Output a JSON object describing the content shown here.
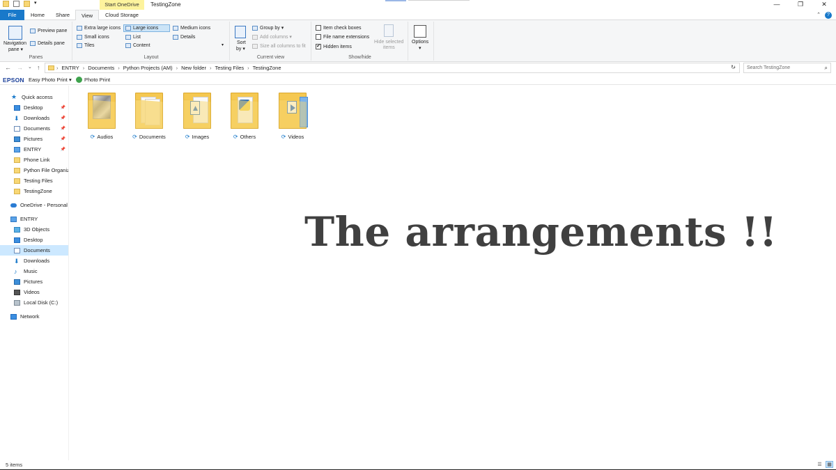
{
  "window": {
    "title": "TestingZone",
    "contextual_tab": "Start OneDrive",
    "controls": {
      "minimize": "—",
      "maximize": "❐",
      "close": "✕"
    }
  },
  "ribbon_tabs": {
    "file": "File",
    "home": "Home",
    "share": "Share",
    "view": "View",
    "cloud": "Cloud Storage",
    "help": "?"
  },
  "ribbon": {
    "panes": {
      "title": "Panes",
      "navigation_pane": "Navigation",
      "navigation_pane_sub": "pane ▾",
      "preview_pane": "Preview pane",
      "details_pane": "Details pane"
    },
    "layout": {
      "title": "Layout",
      "extra_large": "Extra large icons",
      "large": "Large icons",
      "medium": "Medium icons",
      "small": "Small icons",
      "list": "List",
      "details": "Details",
      "tiles": "Tiles",
      "content": "Content"
    },
    "current_view": {
      "title": "Current view",
      "sort": "Sort",
      "sort_sub": "by ▾",
      "group_by": "Group by ▾",
      "add_columns": "Add columns ▾",
      "size_columns": "Size all columns to fit"
    },
    "show_hide": {
      "title": "Show/hide",
      "item_checkboxes": "Item check boxes",
      "file_extensions": "File name extensions",
      "hidden_items": "Hidden items",
      "hidden_checked": "✔",
      "hide_selected": "Hide selected",
      "hide_selected_sub": "items"
    },
    "options": {
      "label": "Options",
      "arrow": "▾"
    }
  },
  "address_bar": {
    "back": "←",
    "forward": "→",
    "recent": "⌄",
    "up": "↑",
    "breadcrumbs": [
      "ENTRY",
      "Documents",
      "Python Projects (AM)",
      "New folder",
      "Testing Files",
      "TestingZone"
    ],
    "separator": "›",
    "dropdown": "⌄",
    "refresh": "↻"
  },
  "search": {
    "placeholder": "Search TestingZone",
    "icon": "⌕"
  },
  "epson_toolbar": {
    "logo": "EPSON",
    "app": "Easy Photo Print",
    "dropdown": "▾",
    "photo_print": "Photo Print"
  },
  "nav_pane": {
    "quick_access": "Quick access",
    "quick_items": [
      "Desktop",
      "Downloads",
      "Documents",
      "Pictures",
      "ENTRY",
      "Phone Link",
      "Python File Organiz",
      "Testing Files",
      "TestingZone"
    ],
    "onedrive": "OneDrive - Personal",
    "this_pc": "ENTRY",
    "pc_items": [
      "3D Objects",
      "Desktop",
      "Documents",
      "Downloads",
      "Music",
      "Pictures",
      "Videos",
      "Local Disk (C:)"
    ],
    "network": "Network",
    "selected": "Documents"
  },
  "folders": [
    {
      "name": "Audios",
      "thumb": "audio-image"
    },
    {
      "name": "Documents",
      "thumb": "papers"
    },
    {
      "name": "Images",
      "thumb": "image-file"
    },
    {
      "name": "Others",
      "thumb": "python-file"
    },
    {
      "name": "Videos",
      "thumb": "video-file"
    }
  ],
  "sync_glyph": "⟳",
  "headline": "The arrangements !!",
  "status": {
    "items": "5 items"
  },
  "colors": {
    "accent": "#1979ca",
    "folder": "#f8d775",
    "contextual_tab": "#fdf39d",
    "selected": "#cce8ff",
    "headline": "#404040"
  }
}
